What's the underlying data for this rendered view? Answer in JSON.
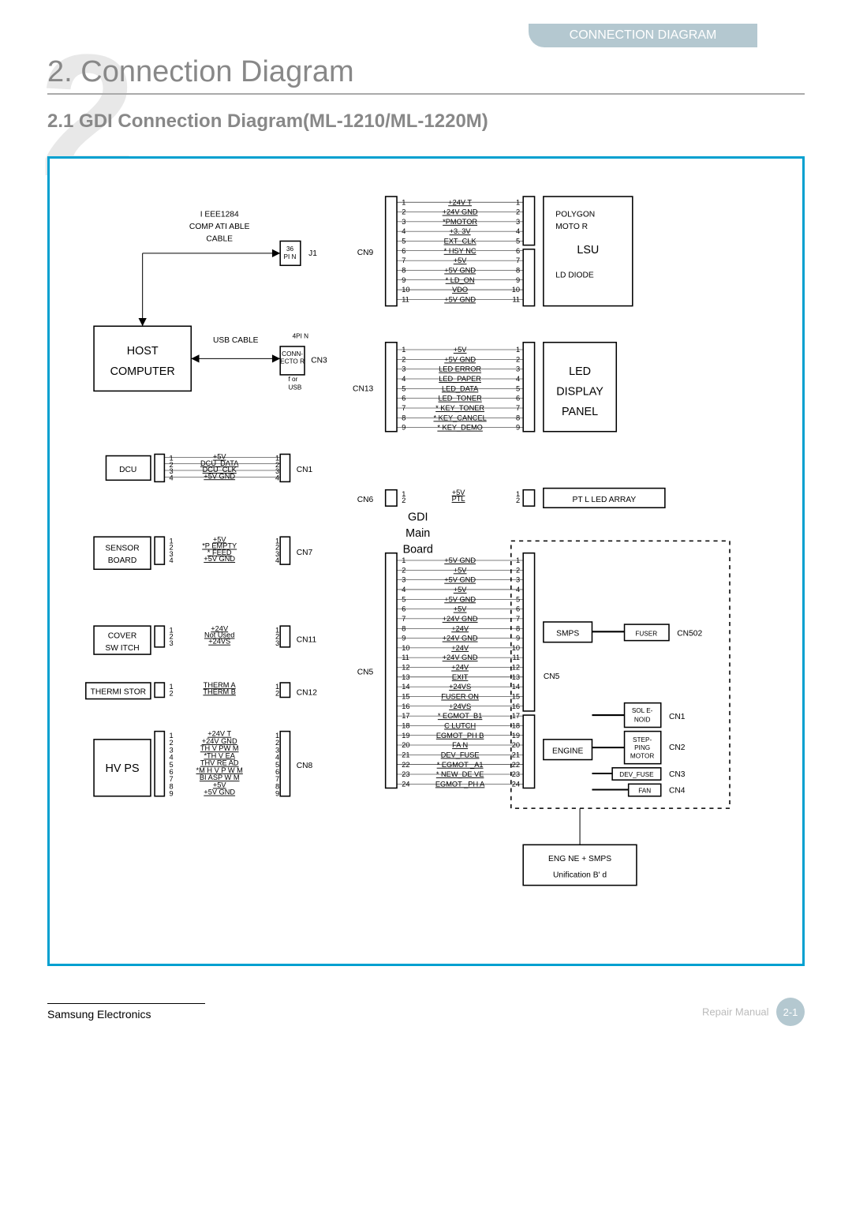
{
  "header_tab": "CONNECTION DIAGRAM",
  "chapter_title": "2.  Connection Diagram",
  "section_title": "2.1 GDI Connection Diagram(ML-1210/ML-1220M)",
  "bg_number": "2",
  "footer_left": "Samsung Electronics",
  "footer_right": "Repair Manual",
  "page_number": "2-1",
  "blocks": {
    "host": "HOST\nCOMPUTER",
    "dcu": "DCU",
    "sensor": "SENSOR\nBOARD",
    "cover": "COVER\nSW ITCH",
    "therm": "THERMI STOR",
    "hvps": "HV PS",
    "gdi": "GDI\nMain\nBoard",
    "polygon": "POLYGON\nMOTO R",
    "lsu": "LSU",
    "ld": "LD DIODE",
    "led": "LED\nDISPLAY\nPANEL",
    "ptl": "PT L  LED ARRAY",
    "smps": "SMPS",
    "engine": "ENGINE",
    "fuser": "FUSER",
    "sole": "SOL E-\nNOID",
    "step": "STEP-\nPING\nMOTOR",
    "dev": "DEV_FUSE",
    "fan": "FAN",
    "unif": "ENG NE  +  SMPS\nUnification B' d"
  },
  "cables": {
    "ieee": "I EEE1284\nCOMP ATI ABLE\nCABLE",
    "usb": "USB CABLE",
    "pin36": "36\nPI N",
    "j1": "J1",
    "pin4": "4PI N",
    "conn": "CONN-\nECTO R\nf or\nUSB"
  },
  "connectors": {
    "cn1": "CN1",
    "cn3": "CN3",
    "cn5": "CN5",
    "cn5b": "CN5",
    "cn6": "CN6",
    "cn7": "CN7",
    "cn8": "CN8",
    "cn9": "CN9",
    "cn11": "CN11",
    "cn12": "CN12",
    "cn13": "CN13",
    "cn502": "CN502",
    "cn1r": "CN1",
    "cn2r": "CN2",
    "cn3r": "CN3",
    "cn4r": "CN4"
  },
  "signals": {
    "cn9": [
      "+24V T",
      "+24V GND",
      "*PMOTOR",
      "+3. 3V",
      "EXT_CLK",
      "* HSY NC",
      "+5V",
      "+5V GND",
      "* LD_ON",
      "VDO",
      "+5V GND"
    ],
    "cn13": [
      "+5V",
      "+5V  GND",
      "LED ERROR",
      "LED_PAPER",
      "LED_DATA",
      "LED_TONER",
      "* KEY_TONER",
      "* KEY_CANCEL",
      "* KEY_DEMO"
    ],
    "cn6": [
      "+5V",
      "PTL"
    ],
    "dcu": [
      "+5V",
      "DCU_DATA",
      "DCU_CLK",
      "+5V  GND"
    ],
    "cn7": [
      "+5V",
      "*P EMPTY",
      "* FEED",
      "+5V GND"
    ],
    "cn11": [
      "+24V",
      "Not Used",
      "+24VS"
    ],
    "cn12": [
      "THERM A",
      "THERM B"
    ],
    "cn8": [
      "+24V T",
      "+24V GND",
      "TH V PW M",
      "*TH V EA",
      "THV RE AD",
      "*M H V P W M",
      "BI ASP W M",
      "+5V",
      "+5V  GND"
    ],
    "cn5": [
      "+5V GND",
      "+5V",
      "+5V GND",
      "+5V",
      "+5V GND",
      "+5V",
      "+24V GND",
      "+24V",
      "+24V GND",
      "+24V",
      "+24V GND",
      "+24V",
      "EXIT",
      "+24VS",
      "FUSER ON",
      "+24VS",
      "* EGMOT_B1",
      "C LUTCH",
      "EGMOT_PH B",
      "FA N",
      "DEV_FUSE",
      "* EGMOT _A1",
      "* NEW_DE VE",
      "EGMOT _PH A"
    ]
  }
}
